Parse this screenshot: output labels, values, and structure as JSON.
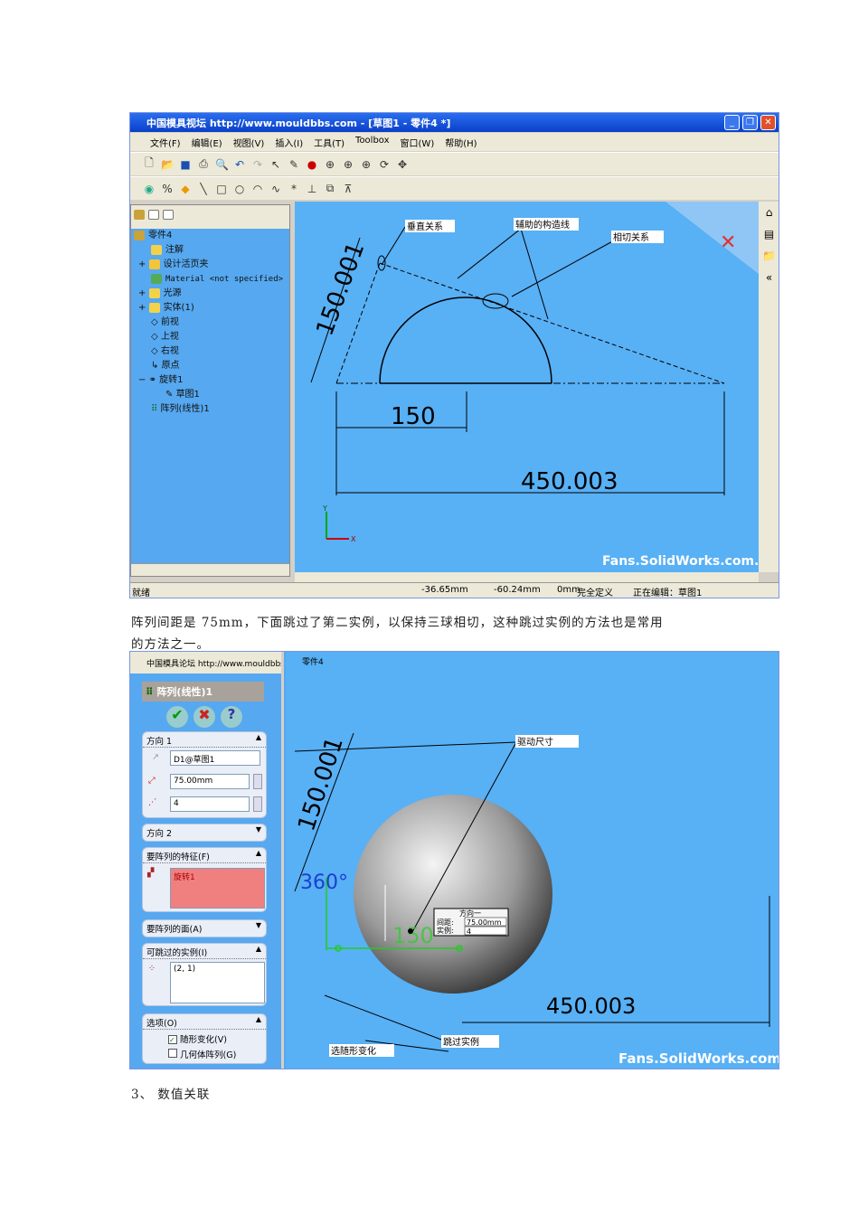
{
  "shot1": {
    "window_title": "中国模具视坛 http://www.mouldbbs.com - [草图1 - 零件4 *]",
    "menu": [
      "文件(F)",
      "编辑(E)",
      "视图(V)",
      "插入(I)",
      "工具(T)",
      "Toolbox",
      "窗口(W)",
      "帮助(H)"
    ],
    "tree": {
      "root": "零件4",
      "items": [
        "注解",
        "设计活页夹",
        "Material <not specified>",
        "光源",
        "实体(1)",
        "前视",
        "上视",
        "右视",
        "原点",
        "旋转1",
        "草图1",
        "阵列(线性)1"
      ]
    },
    "annotations": {
      "perpendicular": "垂直关系",
      "construction": "辅助的构造线",
      "tangent": "相切关系"
    },
    "dims": {
      "angled": "150.001",
      "short": "150",
      "long": "450.003"
    },
    "axis_x": "X",
    "axis_y": "Y",
    "watermark": "Fans.SolidWorks.com.cn",
    "status": {
      "ready": "就绪",
      "x": "-36.65mm",
      "y": "-60.24mm",
      "z": "0mm",
      "state": "完全定义",
      "editing": "正在编辑：草图1"
    }
  },
  "paragraph1": "阵列间距是 75mm，下面跳过了第二实例，以保持三球相切，这种跳过实例的方法也是常用",
  "paragraph1b": "的方法之一。",
  "shot2": {
    "header_overlay": "中国模具论坛 http://www.mouldbbs.com",
    "part": "零件4",
    "feature_title": "阵列(线性)1",
    "dir1": {
      "label": "方向 1",
      "ref": "D1@草图1",
      "spacing": "75.00mm",
      "count": "4"
    },
    "dir2": "方向 2",
    "features": {
      "label": "要阵列的特征(F)",
      "item": "旋转1"
    },
    "faces": "要阵列的面(A)",
    "skip": {
      "label": "可跳过的实例(I)",
      "item": "(2, 1)"
    },
    "options": {
      "label": "选项(O)",
      "vary": "随形变化(V)",
      "geom": "几何体阵列(G)",
      "vary_checked": true,
      "geom_checked": false
    },
    "annotations": {
      "drive": "驱动尺寸",
      "skip": "跳过实例",
      "vary": "选随形变化"
    },
    "dims": {
      "angled": "150.001",
      "angle": "360°",
      "short": "150",
      "long": "450.003"
    },
    "callout": {
      "title": "方向一",
      "spacing_label": "间距:",
      "spacing": "75.00mm",
      "count_label": "实例:",
      "count": "4"
    },
    "watermark": "Fans.SolidWorks.com.cn"
  },
  "heading3": "3、 数值关联",
  "colors": {
    "viewport": "#58b0f5",
    "titlebar": "#0a3fc8",
    "pink": "#f08080"
  }
}
